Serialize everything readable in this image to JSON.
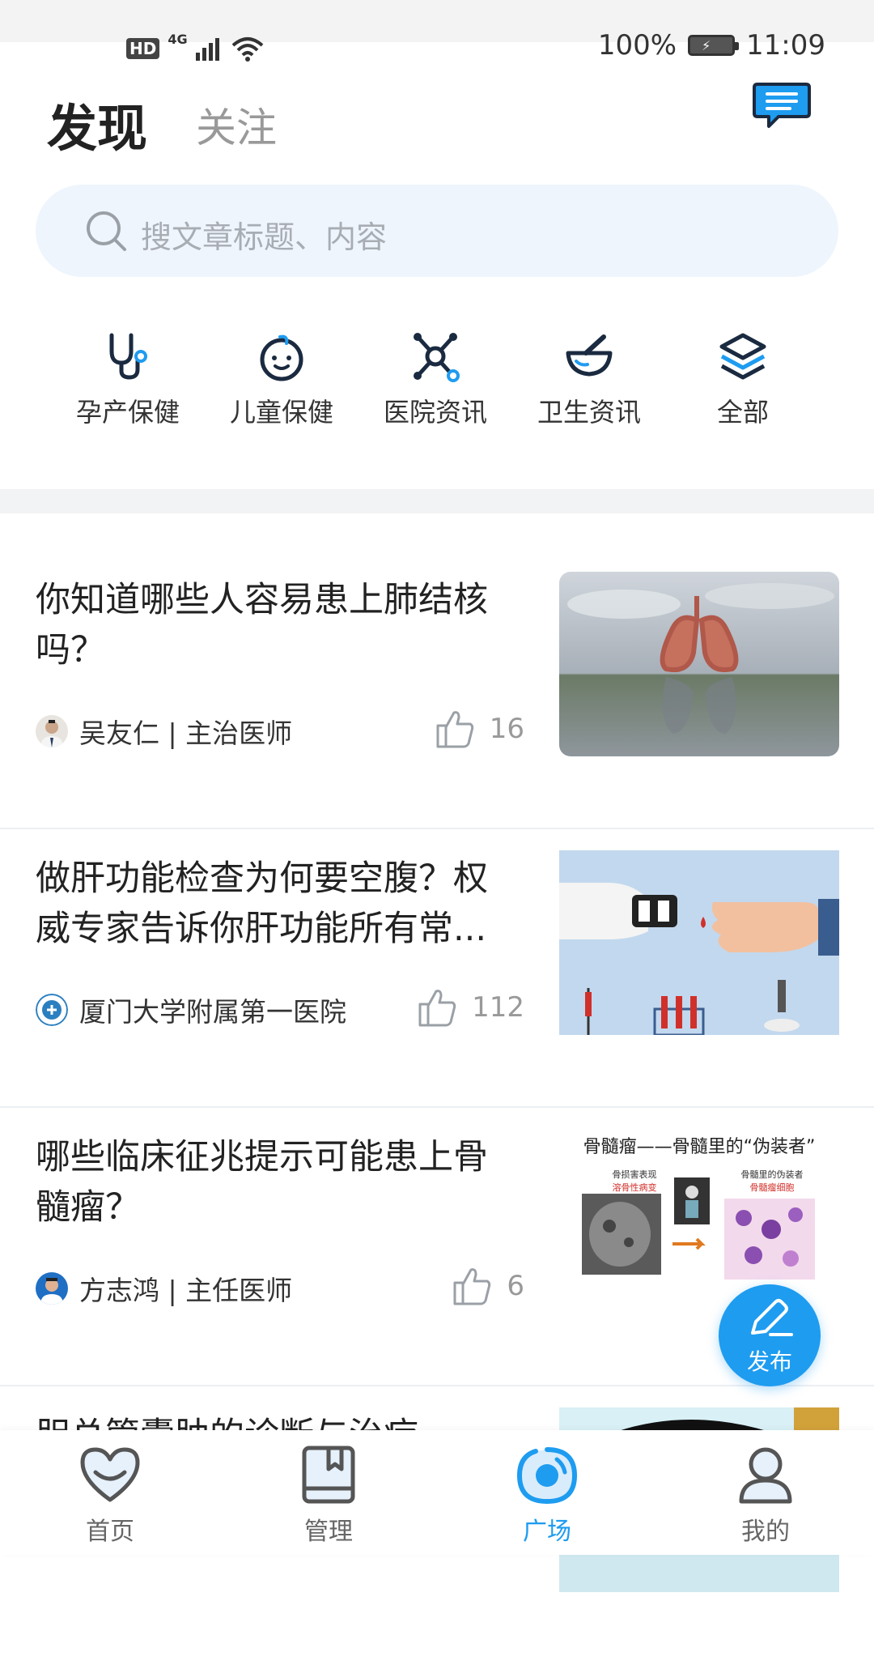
{
  "status_bar": {
    "hd": "HD",
    "network": "4G",
    "battery": "100%",
    "time": "11:09"
  },
  "header": {
    "tabs": [
      {
        "label": "发现",
        "active": true
      },
      {
        "label": "关注",
        "active": false
      }
    ],
    "message_icon": "message-icon"
  },
  "search": {
    "placeholder": "搜文章标题、内容",
    "icon": "search-icon"
  },
  "categories": [
    {
      "label": "孕产保健",
      "icon": "stethoscope-icon"
    },
    {
      "label": "儿童保健",
      "icon": "baby-face-icon"
    },
    {
      "label": "医院资讯",
      "icon": "network-nodes-icon"
    },
    {
      "label": "卫生资讯",
      "icon": "mortar-pestle-icon"
    },
    {
      "label": "全部",
      "icon": "layers-icon"
    }
  ],
  "articles": [
    {
      "title": "你知道哪些人容易患上肺结核吗？",
      "author": "吴友仁 | 主治医师",
      "likes": "16",
      "image": "lungs-photo"
    },
    {
      "title": "做肝功能检查为何要空腹？权威专家告诉你肝功能所有常...",
      "author": "厦门大学附属第一医院",
      "likes": "112",
      "image": "blood-test-illustration"
    },
    {
      "title": "哪些临床征兆提示可能患上骨髓瘤？",
      "author": "方志鸿 | 主任医师",
      "likes": "6",
      "image": "myeloma-infographic"
    },
    {
      "title": "胆总管囊肿的诊断与治疗",
      "image": "partial-image"
    }
  ],
  "myeloma_image_text": {
    "headline": "骨髓瘤——骨髓里的“伪装者”",
    "left_caption": "骨损害表现",
    "left_sub": "溶骨性病变",
    "right_caption": "骨髓里的伪装者",
    "right_sub": "骨髓瘤细胞"
  },
  "fab": {
    "label": "发布",
    "icon": "pen-icon"
  },
  "bottom_nav": [
    {
      "label": "首页",
      "icon": "heart-icon",
      "active": false
    },
    {
      "label": "管理",
      "icon": "book-icon",
      "active": false
    },
    {
      "label": "广场",
      "icon": "plaza-icon",
      "active": true
    },
    {
      "label": "我的",
      "icon": "user-icon",
      "active": false
    }
  ],
  "colors": {
    "accent": "#1e9cf0",
    "icon_dark": "#1a2a40",
    "muted": "#999999",
    "search_bg": "#eef5fd"
  }
}
